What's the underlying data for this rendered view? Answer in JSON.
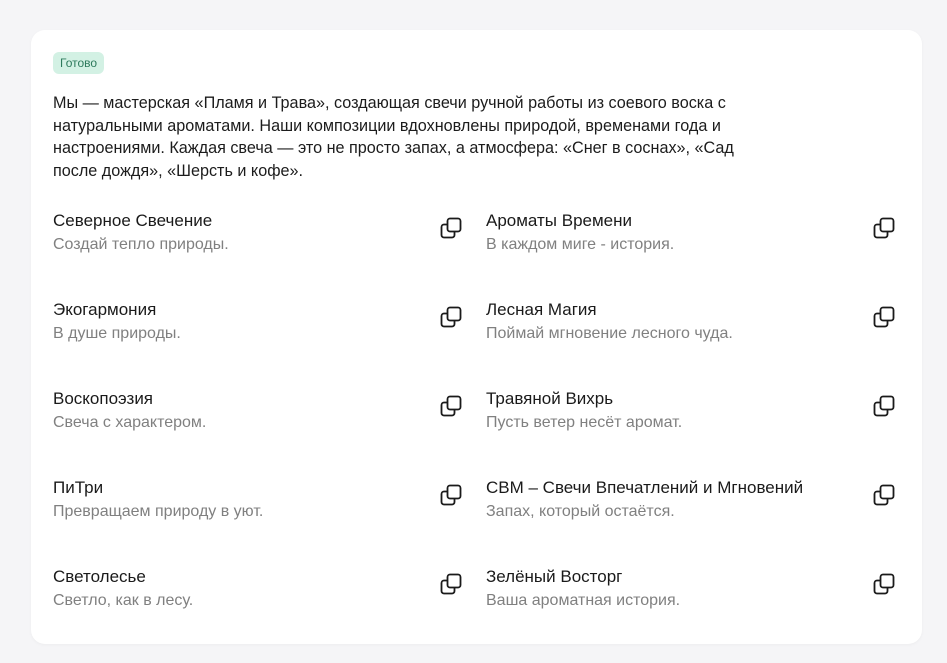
{
  "status_badge": "Готово",
  "intro_text": "Мы — мастерская «Пламя и Трава», создающая свечи ручной работы из соевого воска с натуральными ароматами. Наши композиции вдохновлены природой, временами года и настроениями. Каждая свеча — это не просто запах, а атмосфера: «Снег в соснах», «Сад после дождя», «Шерсть и кофе».",
  "items": [
    {
      "name": "Северное Свечение",
      "desc": "Создай тепло природы."
    },
    {
      "name": "Ароматы Времени",
      "desc": "В каждом миге - история."
    },
    {
      "name": "Экогармония",
      "desc": "В душе природы."
    },
    {
      "name": "Лесная Магия",
      "desc": "Поймай мгновение лесного чуда."
    },
    {
      "name": "Воскопоэзия",
      "desc": "Свеча с характером."
    },
    {
      "name": "Травяной Вихрь",
      "desc": "Пусть ветер несёт аромат."
    },
    {
      "name": "ПиТри",
      "desc": "Превращаем природу в уют."
    },
    {
      "name": "СВМ – Свечи Впечатлений и Мгновений",
      "desc": "Запах, который остаётся."
    },
    {
      "name": "Светолесье",
      "desc": "Светло, как в лесу."
    },
    {
      "name": "Зелёный Восторг",
      "desc": "Ваша ароматная история."
    }
  ],
  "icons": {
    "copy": "copy-icon"
  },
  "colors": {
    "badge_bg": "#d3f1e4",
    "badge_text": "#2d7a5c",
    "desc_text": "#808080"
  }
}
